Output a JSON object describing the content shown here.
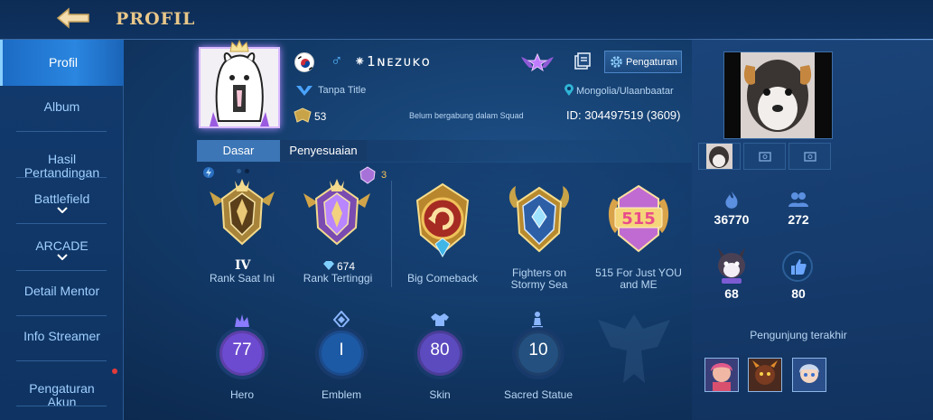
{
  "header": {
    "title": "PROFIL"
  },
  "sidebar": {
    "items": [
      {
        "label": "Profil"
      },
      {
        "label": "Album"
      },
      {
        "label": "Hasil\nPertandingan"
      },
      {
        "label": "Battlefield"
      },
      {
        "label": "ARCADE"
      },
      {
        "label": "Detail Mentor"
      },
      {
        "label": "Info Streamer"
      },
      {
        "label": "Pengaturan\nAkun"
      }
    ]
  },
  "profile": {
    "username": "⁕1ɴᴇᴢᴜᴋᴏ",
    "title": "Tanpa Title",
    "level": "53",
    "squad": "Belum bergabung dalam Squad",
    "location": "Mongolia/Ulaanbaatar",
    "id": "ID: 304497519 (3609)",
    "settings_label": "Pengaturan"
  },
  "tabs": [
    {
      "label": "Dasar"
    },
    {
      "label": "Penyesuaian"
    }
  ],
  "achievements": {
    "rank_current": {
      "roman": "IV",
      "label": "Rank Saat Ini"
    },
    "rank_highest": {
      "stars": "674",
      "label": "Rank Tertinggi",
      "badge_count": "3"
    },
    "items": [
      {
        "label": "Big Comeback"
      },
      {
        "label": "Fighters on\nStormy Sea"
      },
      {
        "label": "515 For Just YOU\nand ME"
      }
    ]
  },
  "stats": [
    {
      "value": "77",
      "label": "Hero"
    },
    {
      "value": "I",
      "label": "Emblem"
    },
    {
      "value": "80",
      "label": "Skin"
    },
    {
      "value": "10",
      "label": "Sacred Statue"
    }
  ],
  "right": {
    "popularity": "36770",
    "followers": "272",
    "pets": "68",
    "likes": "80",
    "visitor_label": "Pengunjung terakhir"
  }
}
